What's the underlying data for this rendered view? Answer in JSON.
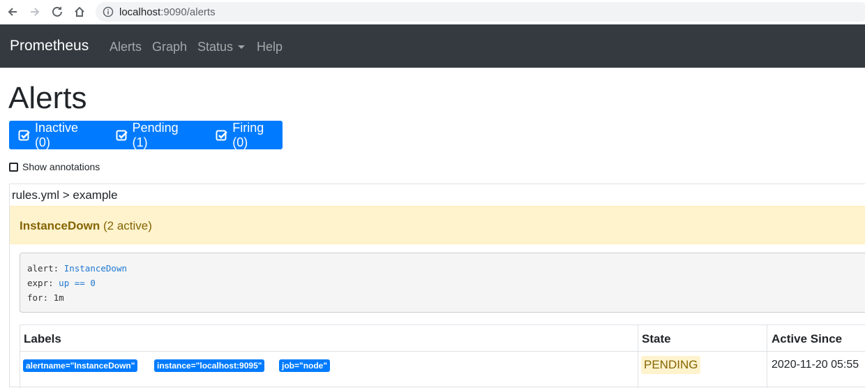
{
  "browser": {
    "url_host": "localhost",
    "url_rest": ":9090/alerts"
  },
  "navbar": {
    "brand": "Prometheus",
    "links": [
      "Alerts",
      "Graph",
      "Status",
      "Help"
    ]
  },
  "page": {
    "title": "Alerts",
    "filters": [
      {
        "label": "Inactive (0)"
      },
      {
        "label": "Pending (1)"
      },
      {
        "label": "Firing (0)"
      }
    ],
    "show_annotations": "Show annotations"
  },
  "rule_group": {
    "header": "rules.yml > example",
    "alert_name": "InstanceDown",
    "alert_count": "(2 active)",
    "definition": {
      "alert_key": "alert:",
      "alert_val": "InstanceDown",
      "expr_key": "expr:",
      "expr_val": "up == 0",
      "for_key": "for:",
      "for_val": "1m"
    },
    "table": {
      "headers": [
        "Labels",
        "State",
        "Active Since"
      ],
      "row": {
        "labels": [
          "alertname=\"InstanceDown\"",
          "instance=\"localhost:9095\"",
          "job=\"node\""
        ],
        "state": "PENDING",
        "active_since": "2020-11-20 05:55"
      }
    }
  },
  "colors": {
    "navbar_bg": "#343a40",
    "primary": "#007bff",
    "warning_bg": "#fff3cd",
    "warning_text": "#856404"
  }
}
